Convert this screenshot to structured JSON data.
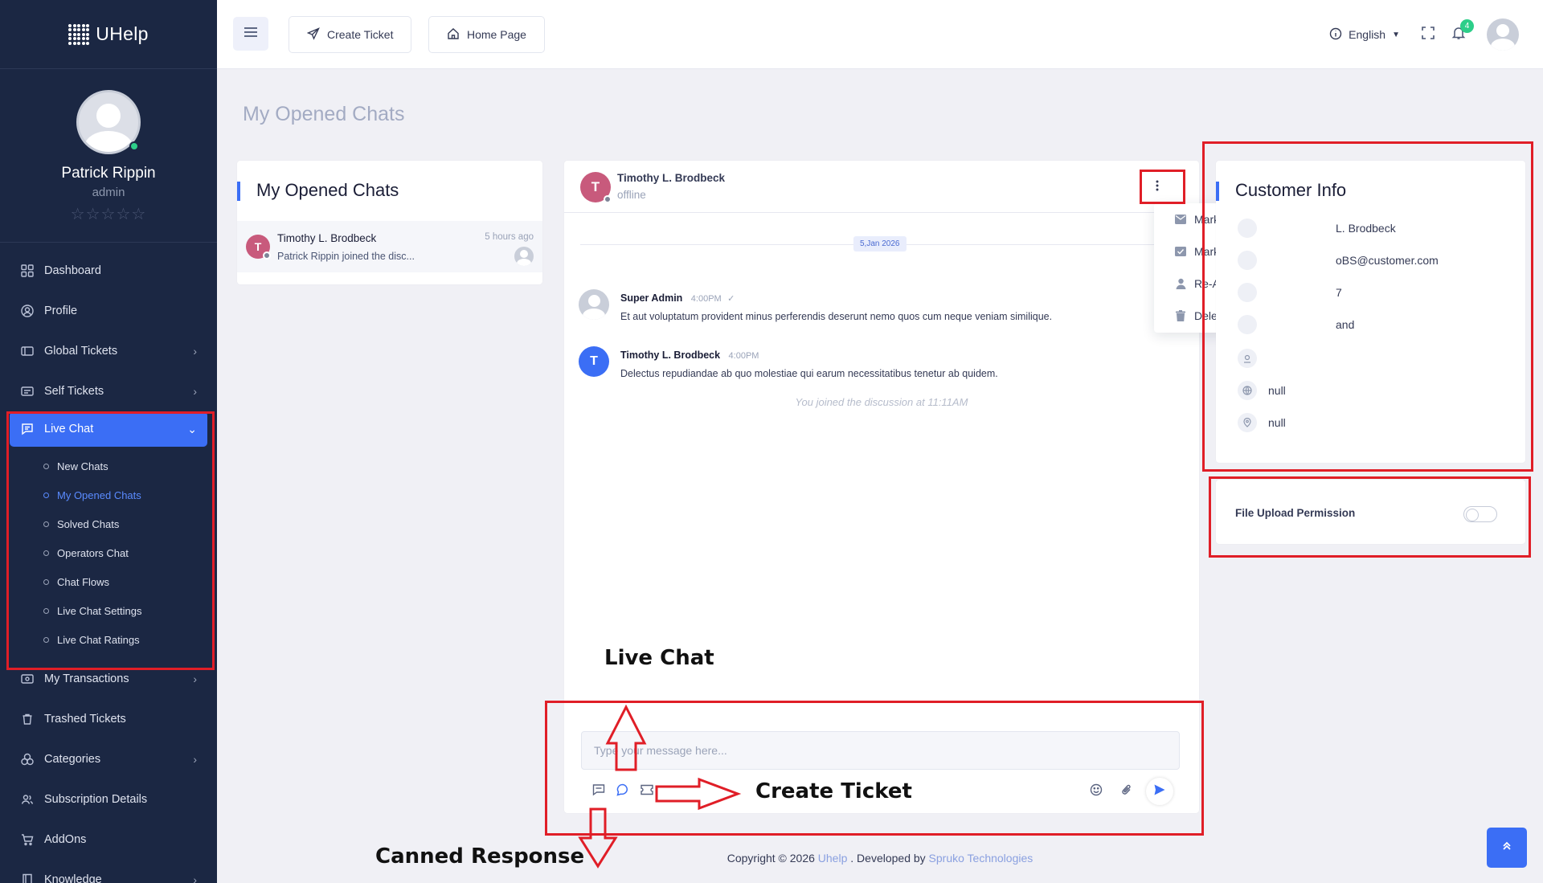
{
  "brand": {
    "name": "UHelp"
  },
  "profile": {
    "name": "Patrick Rippin",
    "role": "admin",
    "stars": "☆☆☆☆☆"
  },
  "sidebar": {
    "items": [
      {
        "label": "Dashboard",
        "icon": "grid-icon"
      },
      {
        "label": "Profile",
        "icon": "user-icon"
      },
      {
        "label": "Global Tickets",
        "icon": "ticket-icon",
        "chevron": "›"
      },
      {
        "label": "Self Tickets",
        "icon": "ticket-icon",
        "chevron": "›"
      },
      {
        "label": "Live Chat",
        "icon": "chat-icon",
        "chevron": "⌄"
      },
      {
        "label": "My Transactions",
        "icon": "wallet-icon",
        "chevron": "›"
      },
      {
        "label": "Trashed Tickets",
        "icon": "trash-icon"
      },
      {
        "label": "Categories",
        "icon": "category-icon",
        "chevron": "›"
      },
      {
        "label": "Subscription Details",
        "icon": "users-icon"
      },
      {
        "label": "AddOns",
        "icon": "cart-icon"
      },
      {
        "label": "Knowledge",
        "icon": "book-icon",
        "chevron": "›"
      }
    ],
    "livechat_sub": [
      "New Chats",
      "My Opened Chats",
      "Solved Chats",
      "Operators Chat",
      "Chat Flows",
      "Live Chat Settings",
      "Live Chat Ratings"
    ]
  },
  "header": {
    "create_ticket": "Create Ticket",
    "home_page": "Home Page",
    "language": "English",
    "notification_count": "4"
  },
  "page": {
    "title": "My Opened Chats"
  },
  "chat_list": {
    "title": "My Opened Chats",
    "items": [
      {
        "initial": "T",
        "name": "Timothy L. Brodbeck",
        "time": "5 hours ago",
        "preview": "Patrick Rippin joined the disc..."
      }
    ]
  },
  "chat": {
    "contact_initial": "T",
    "contact_name": "Timothy L. Brodbeck",
    "contact_status": "offline",
    "date": "5,Jan 2026",
    "messages": [
      {
        "name": "Super Admin",
        "time": "4:00PM",
        "tick": "✓",
        "text": "Et aut voluptatum provident minus perferendis deserunt nemo quos cum neque veniam similique."
      },
      {
        "initial": "T",
        "name": "Timothy L. Brodbeck",
        "time": "4:00PM",
        "text": "Delectus repudiandae ab quo molestiae qui earum necessitatibus tenetur ab quidem."
      }
    ],
    "system_note": "You joined the discussion at 11:11AM",
    "composer_placeholder": "Type your message here..."
  },
  "dropdown": {
    "items": [
      {
        "label": "Mark As Unread",
        "icon": "mail-icon"
      },
      {
        "label": "Mark As Solved",
        "icon": "mail-check-icon"
      },
      {
        "label": "Re-Assign",
        "icon": "user-icon"
      },
      {
        "label": "Delete",
        "icon": "trash-icon"
      }
    ]
  },
  "customer_info": {
    "title": "Customer Info",
    "rows": [
      {
        "value": "L. Brodbeck",
        "icon": "user-icon"
      },
      {
        "value": "oBS@customer.com",
        "icon": "mail-icon"
      },
      {
        "value": "7",
        "icon": "phone-icon"
      },
      {
        "value": "and",
        "icon": "flag-icon"
      },
      {
        "value": "",
        "icon": "location-icon"
      },
      {
        "value": "null",
        "icon": "globe-icon"
      },
      {
        "value": "null",
        "icon": "pin-icon"
      }
    ]
  },
  "file_upload": {
    "label": "File Upload Permission",
    "enabled": false
  },
  "footer": {
    "prefix": "Copyright © 2026 ",
    "brand": "Uhelp",
    "middle": " . Developed by ",
    "company": "Spruko Technologies"
  },
  "annotations": {
    "live_chat": "Live Chat",
    "create_ticket": "Create Ticket",
    "canned_response": "Canned Response"
  },
  "colors": {
    "primary": "#3b6ef5",
    "sidebar": "#1b2743",
    "annotation": "#e01e27",
    "avatar": "#c85a7c",
    "online": "#2dce89"
  }
}
